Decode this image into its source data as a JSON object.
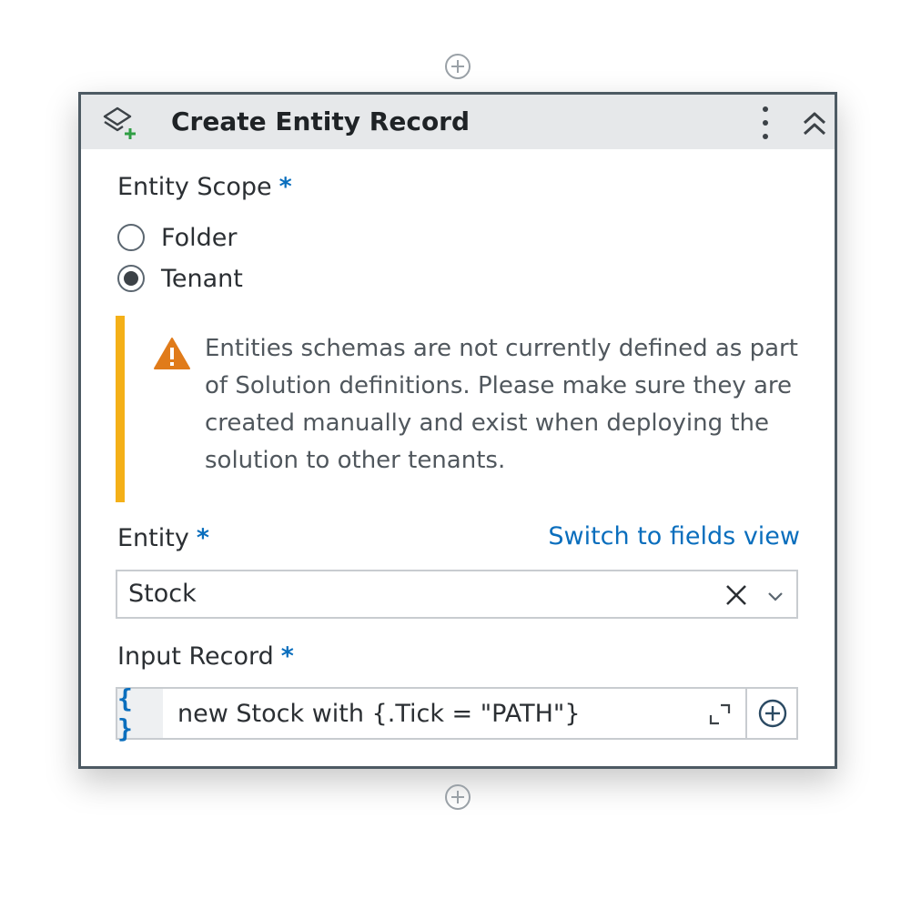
{
  "activity": {
    "title": "Create Entity Record",
    "icons": {
      "header": "layers-add-icon",
      "more": "more-vertical-icon",
      "collapse": "double-chevron-up-icon",
      "add_above": "plus-circle-icon",
      "add_below": "plus-circle-icon"
    }
  },
  "entity_scope": {
    "label": "Entity Scope",
    "required_marker": "*",
    "options": [
      {
        "label": "Folder",
        "selected": false
      },
      {
        "label": "Tenant",
        "selected": true
      }
    ]
  },
  "warning": {
    "icon": "warning-triangle-icon",
    "text": "Entities schemas are not currently defined as part of Solution definitions. Please make sure they are created manually and exist when deploying the solution to other tenants."
  },
  "entity": {
    "label": "Entity",
    "required_marker": "*",
    "switch_link": "Switch to fields view",
    "value": "Stock"
  },
  "input_record": {
    "label": "Input Record",
    "required_marker": "*",
    "braces": "{ }",
    "value": "new Stock with {.Tick = \"PATH\"}"
  },
  "colors": {
    "accent": "#0a6ebd",
    "warning_bar": "#f4b018",
    "warning_icon": "#e07b1a",
    "card_border": "#4d5a63",
    "header_bg": "#e6e8ea",
    "add_icon_green": "#2f9e44"
  }
}
